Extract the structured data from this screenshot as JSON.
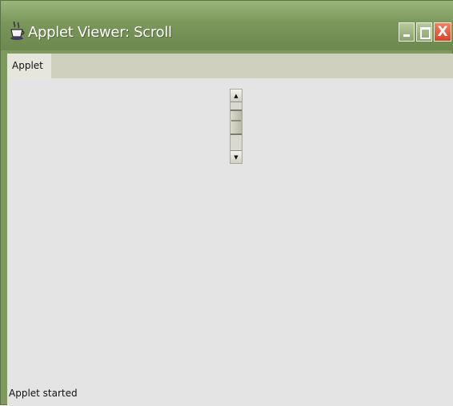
{
  "window": {
    "title": "Applet Viewer: Scroll",
    "icon": "java-cup-icon",
    "controls": {
      "minimize_icon": "minimize-icon",
      "maximize_icon": "maximize-icon",
      "close_label": "X"
    }
  },
  "menubar": {
    "items": [
      {
        "label": "Applet"
      }
    ]
  },
  "scrollbar": {
    "orientation": "vertical",
    "up_arrow": "▲",
    "down_arrow": "▼"
  },
  "statusbar": {
    "text": "Applet started"
  },
  "colors": {
    "titlebar": "#7a9659",
    "close_button": "#d8432a",
    "content_background": "#e4e4e4",
    "menubar": "#d0d0bf"
  }
}
